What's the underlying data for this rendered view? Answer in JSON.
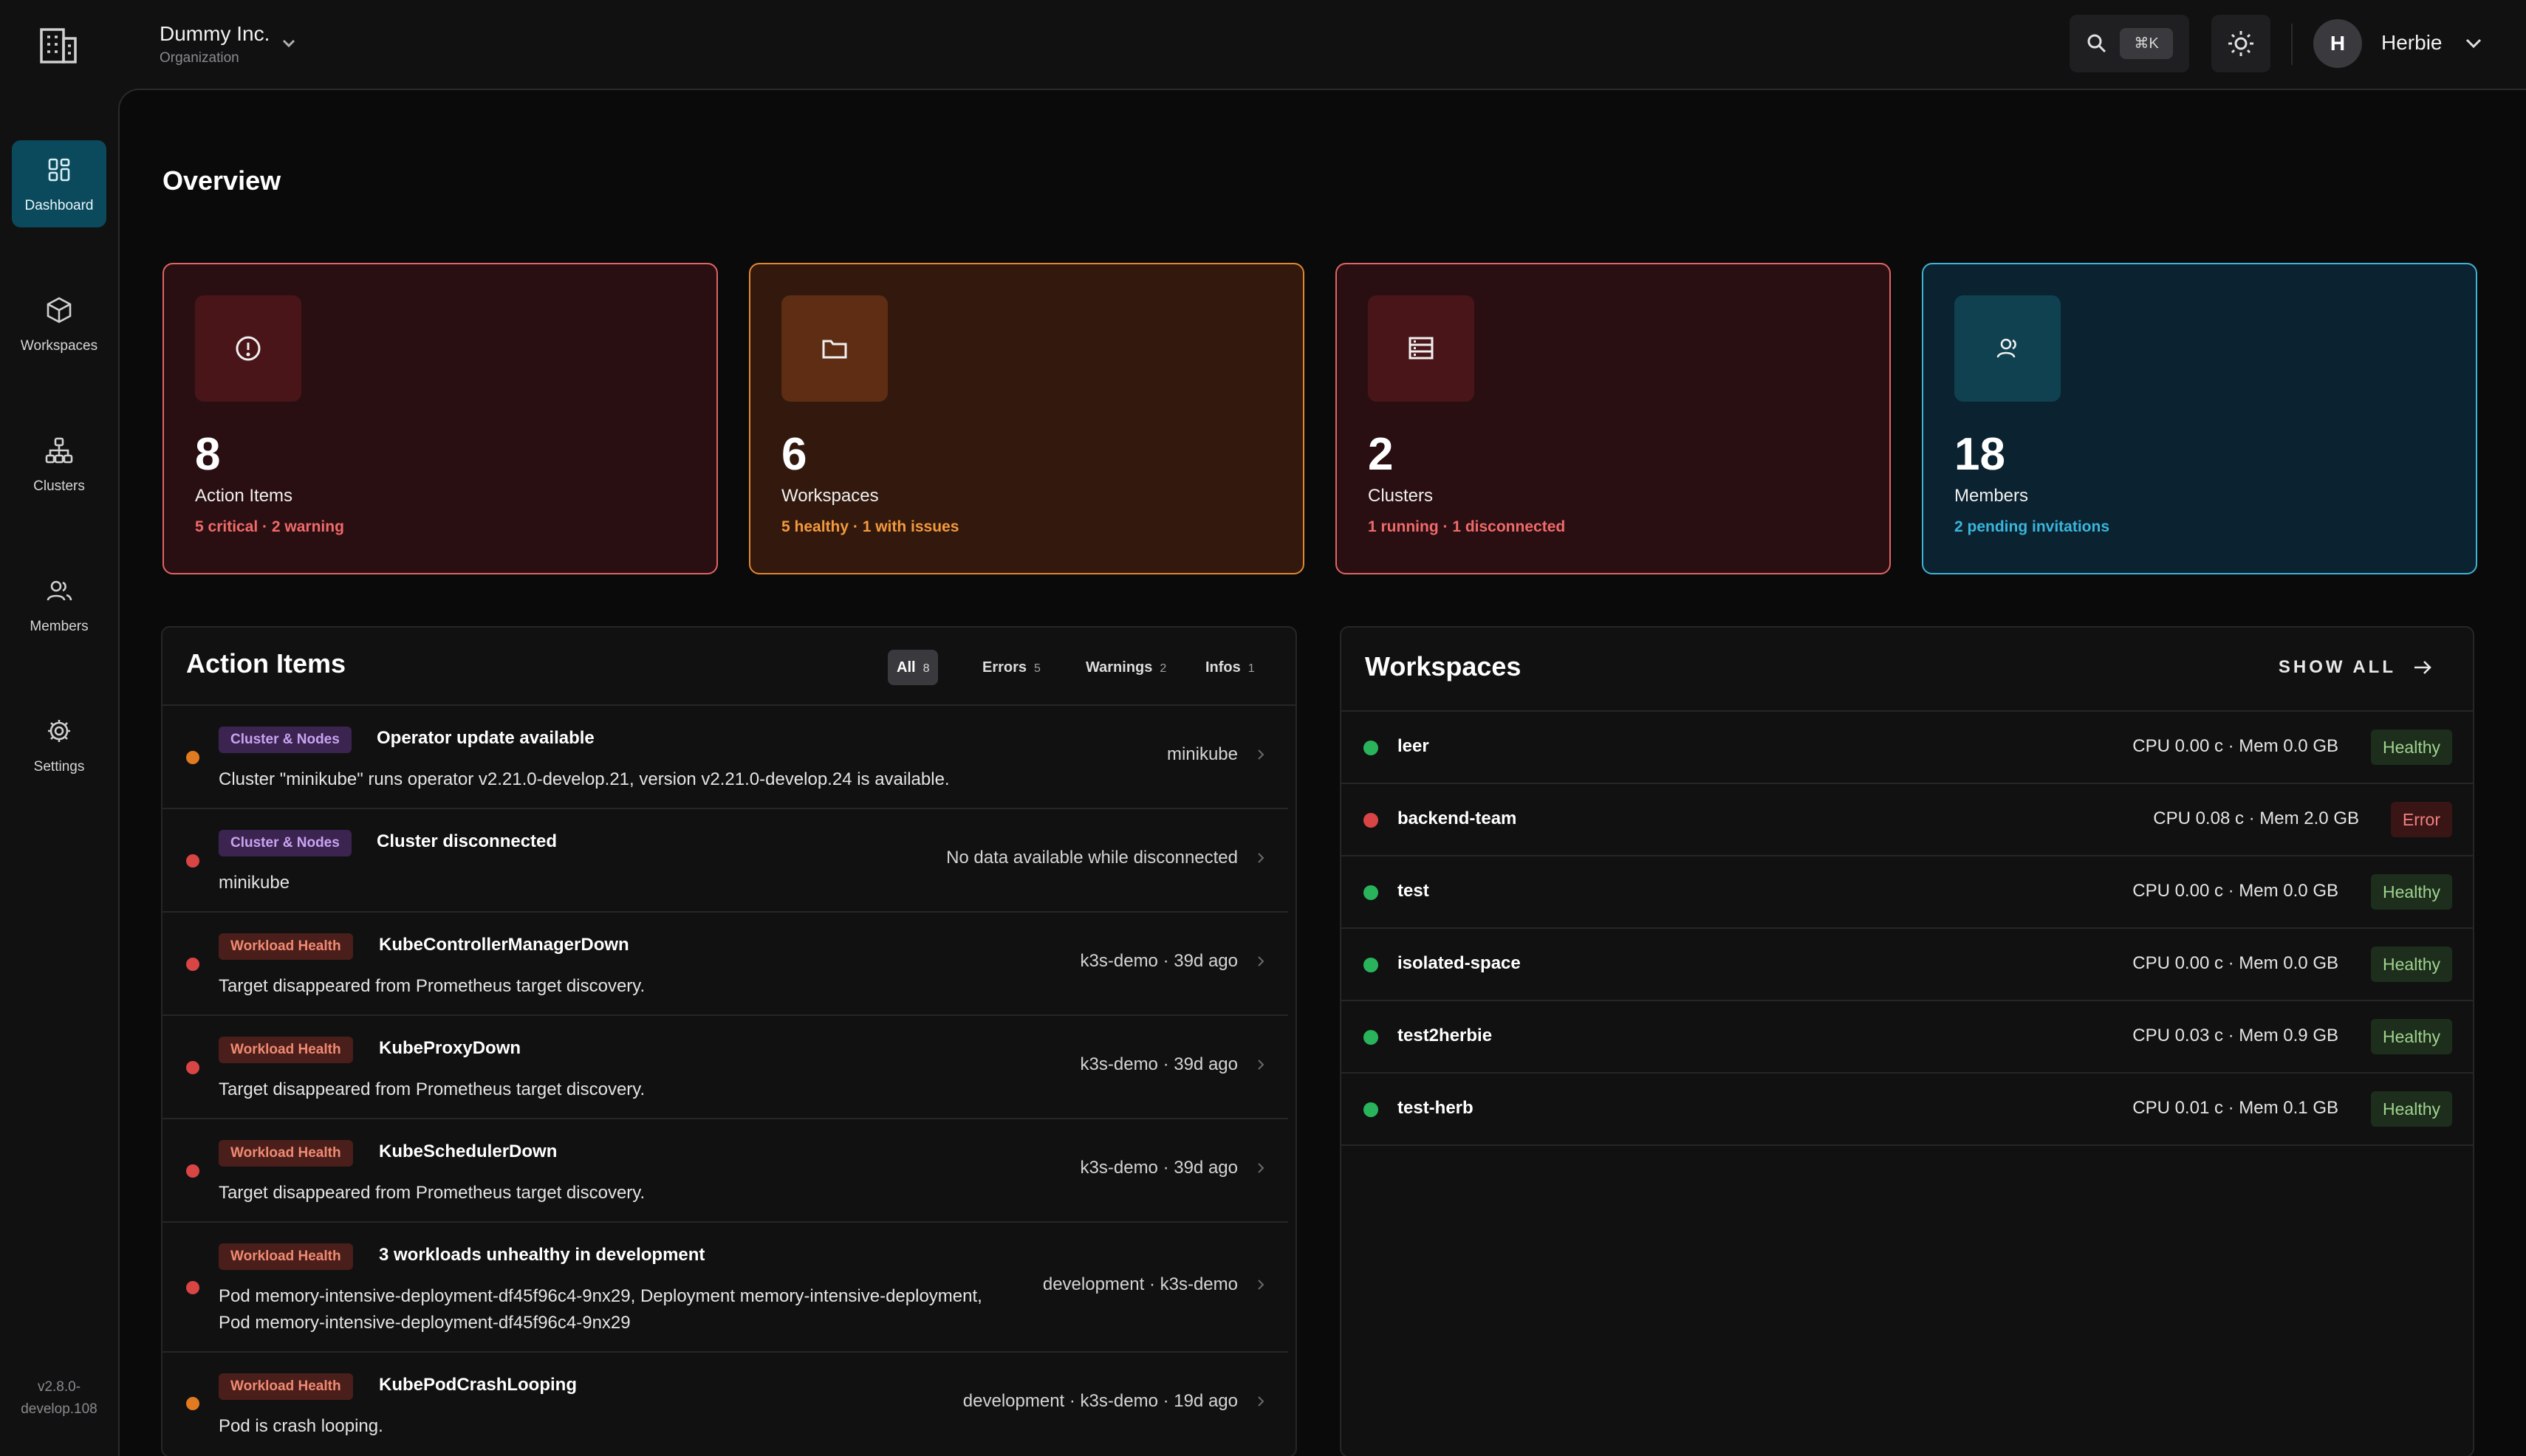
{
  "org": {
    "name": "Dummy Inc.",
    "subtitle": "Organization"
  },
  "topbar": {
    "shortcut": "⌘K",
    "user_initial": "H",
    "user_name": "Herbie"
  },
  "sidebar": {
    "items": [
      {
        "label": "Dashboard",
        "icon": "dashboard-icon",
        "active": true
      },
      {
        "label": "Workspaces",
        "icon": "cube-icon"
      },
      {
        "label": "Clusters",
        "icon": "clusters-icon"
      },
      {
        "label": "Members",
        "icon": "members-icon"
      },
      {
        "label": "Settings",
        "icon": "gear-icon"
      }
    ],
    "version_line1": "v2.8.0-",
    "version_line2": "develop.108"
  },
  "page": {
    "title": "Overview"
  },
  "stats": [
    {
      "value": "8",
      "label": "Action Items",
      "sub": "5 critical · 2 warning",
      "icon": "alert-circle-icon",
      "color": "#e06464"
    },
    {
      "value": "6",
      "label": "Workspaces",
      "sub": "5 healthy · 1 with issues",
      "icon": "folder-icon",
      "color": "#e0872f"
    },
    {
      "value": "2",
      "label": "Clusters",
      "sub": "1 running · 1 disconnected",
      "icon": "server-icon",
      "color": "#e06464"
    },
    {
      "value": "18",
      "label": "Members",
      "sub": "2 pending invitations",
      "icon": "members-icon",
      "color": "#3fb3d6"
    }
  ],
  "action_items": {
    "title": "Action Items",
    "filters": [
      {
        "label": "All",
        "count": "8",
        "active": true
      },
      {
        "label": "Errors",
        "count": "5"
      },
      {
        "label": "Warnings",
        "count": "2"
      },
      {
        "label": "Infos",
        "count": "1"
      }
    ],
    "rows": [
      {
        "tag": "Cluster & Nodes",
        "title": "Operator update available",
        "desc_line1": "Cluster \"minikube\" runs operator v2.21.0-develop.21, version v2.21.0-develop.24 is available.",
        "meta": "minikube",
        "severity": "warning"
      },
      {
        "tag": "Cluster & Nodes",
        "title": "Cluster disconnected",
        "desc_line1": "minikube",
        "meta": "No data available while disconnected",
        "severity": "error"
      },
      {
        "tag": "Workload Health",
        "title": "KubeControllerManagerDown",
        "desc_line1": "Target disappeared from Prometheus target discovery.",
        "meta": "k3s-demo · 39d ago",
        "severity": "error"
      },
      {
        "tag": "Workload Health",
        "title": "KubeProxyDown",
        "desc_line1": "Target disappeared from Prometheus target discovery.",
        "meta": "k3s-demo · 39d ago",
        "severity": "error"
      },
      {
        "tag": "Workload Health",
        "title": "KubeSchedulerDown",
        "desc_line1": "Target disappeared from Prometheus target discovery.",
        "meta": "k3s-demo · 39d ago",
        "severity": "error"
      },
      {
        "tag": "Workload Health",
        "title": "3 workloads unhealthy in development",
        "desc_line1": "Pod memory-intensive-deployment-df45f96c4-9nx29, Deployment memory-intensive-deployment,",
        "desc_line2": "Pod memory-intensive-deployment-df45f96c4-9nx29",
        "meta": "development · k3s-demo",
        "severity": "error"
      },
      {
        "tag": "Workload Health",
        "title": "KubePodCrashLooping",
        "desc_line1": "Pod is crash looping.",
        "meta": "development · k3s-demo · 19d ago",
        "severity": "warning"
      }
    ]
  },
  "workspaces": {
    "title": "Workspaces",
    "show_all": "SHOW ALL",
    "rows": [
      {
        "name": "leer",
        "stats": "CPU 0.00 c · Mem 0.0 GB",
        "status": "Healthy"
      },
      {
        "name": "backend-team",
        "stats": "CPU 0.08 c · Mem 2.0 GB",
        "status": "Error"
      },
      {
        "name": "test",
        "stats": "CPU 0.00 c · Mem 0.0 GB",
        "status": "Healthy"
      },
      {
        "name": "isolated-space",
        "stats": "CPU 0.00 c · Mem 0.0 GB",
        "status": "Healthy"
      },
      {
        "name": "test2herbie",
        "stats": "CPU 0.03 c · Mem 0.9 GB",
        "status": "Healthy"
      },
      {
        "name": "test-herb",
        "stats": "CPU 0.01 c · Mem 0.1 GB",
        "status": "Healthy"
      }
    ]
  }
}
